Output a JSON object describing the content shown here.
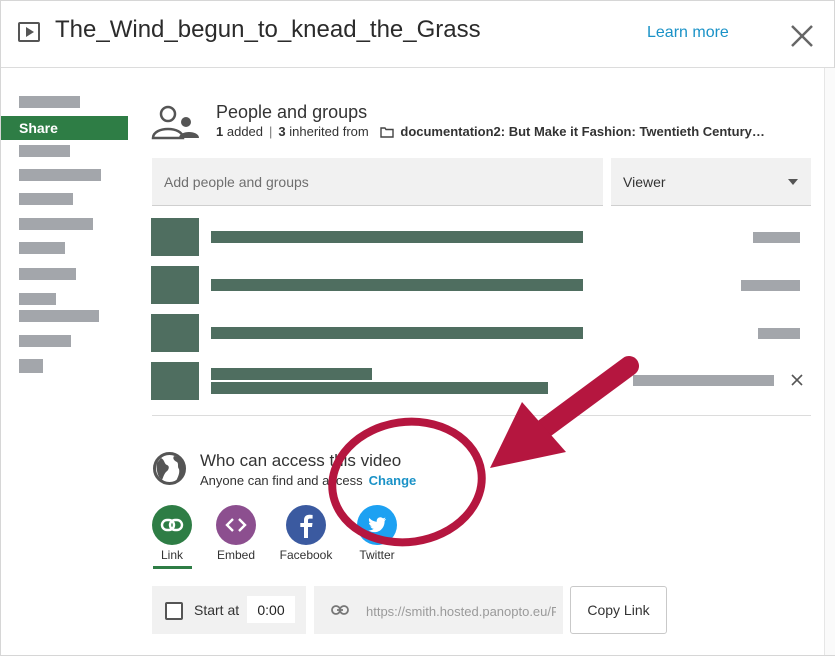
{
  "header": {
    "title": "The_Wind_begun_to_knead_the_Grass",
    "learn_more": "Learn more"
  },
  "sidebar": {
    "active_label": "Share"
  },
  "people": {
    "title": "People and groups",
    "added_count": "1",
    "added_label": "added",
    "inherited_count": "3",
    "inherited_label": "inherited from",
    "folder_name": "documentation2: But Make it Fashion: Twentieth Century…",
    "add_placeholder": "Add people and groups",
    "role": "Viewer"
  },
  "access": {
    "title": "Who can access this video",
    "subtitle": "Anyone can find and access",
    "change": "Change"
  },
  "share_options": [
    {
      "label": "Link"
    },
    {
      "label": "Embed"
    },
    {
      "label": "Facebook"
    },
    {
      "label": "Twitter"
    }
  ],
  "start_at": {
    "label": "Start at",
    "value": "0:00"
  },
  "link": {
    "value": "https://smith.hosted.panopto.eu/Panopto/Pages/Viewer.aspx"
  },
  "copy_link": "Copy Link",
  "colors": {
    "accent_green": "#2e7d45",
    "link_blue": "#1a92c7",
    "annotation_red": "#b5163f"
  }
}
